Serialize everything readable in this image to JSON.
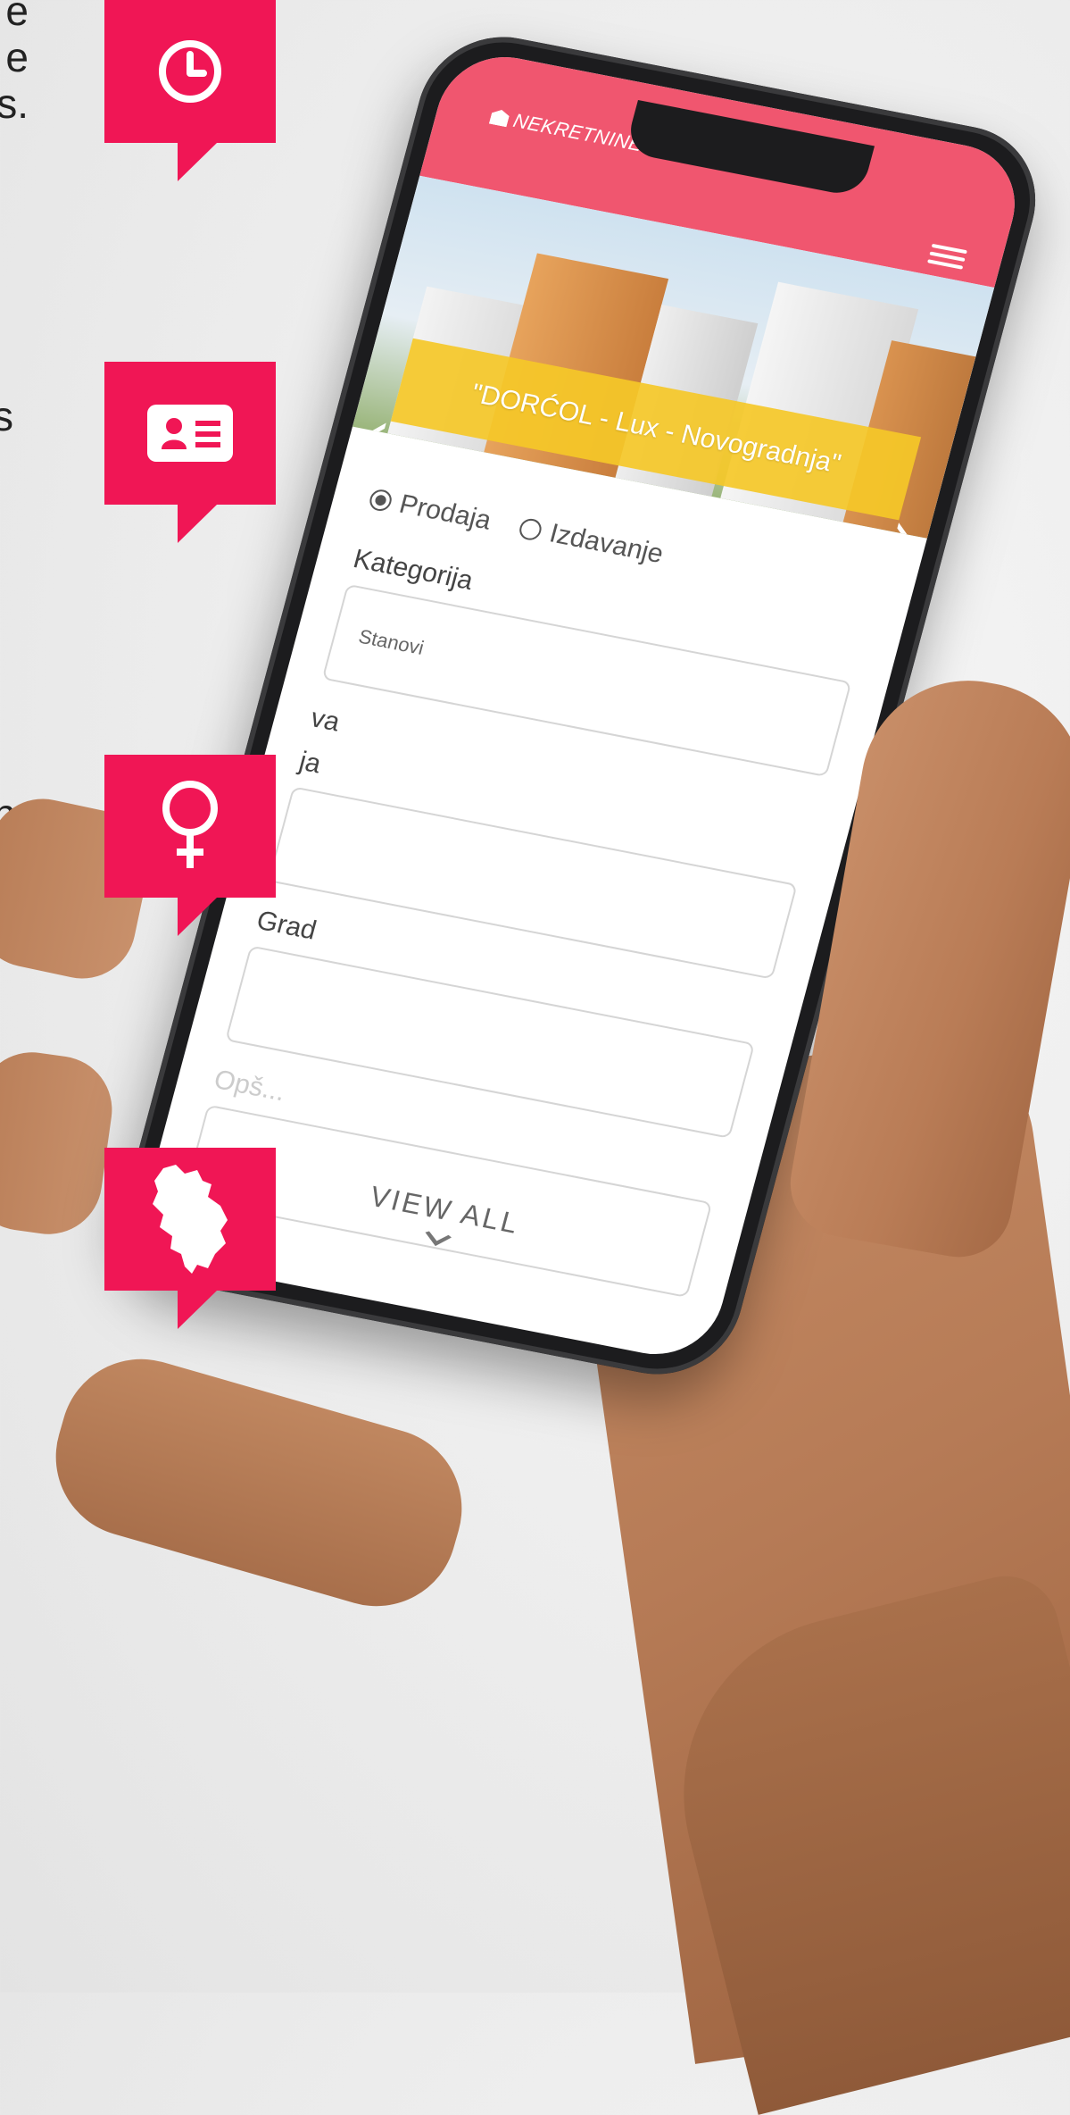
{
  "edge_text": {
    "line1": "e\ne\ns.",
    "line2": "s",
    "line3": "n"
  },
  "app": {
    "logo": "NEKRETNINE.RS",
    "slide_caption": "\"DORĆOL - Lux - Novogradnja\"",
    "form": {
      "radio_sale": "Prodaja",
      "radio_rent": "Izdavanje",
      "sale_selected": true,
      "category_label": "Kategorija",
      "category_value": "Stanovi",
      "country_label": "va",
      "region_label": "ja",
      "city_label": "Grad",
      "city_value": "",
      "municipality_label": "Opš...",
      "municipality_value": ""
    },
    "view_all": "VIEW ALL"
  },
  "pins": [
    {
      "icon": "clock-icon"
    },
    {
      "icon": "id-card-icon"
    },
    {
      "icon": "female-symbol-icon"
    },
    {
      "icon": "serbia-map-icon"
    }
  ],
  "colors": {
    "accent": "#f01655",
    "header": "#f0566f",
    "caption": "#f5c828"
  }
}
